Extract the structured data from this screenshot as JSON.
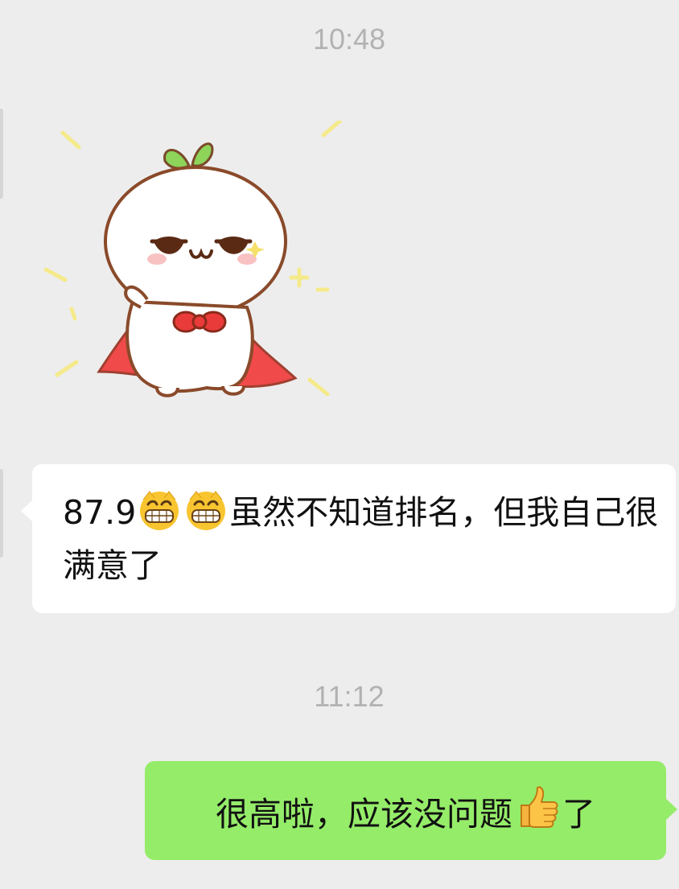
{
  "timestamps": [
    "10:48",
    "11:12"
  ],
  "messages": {
    "received": {
      "score": "87.9",
      "emoji_1": "grinning-face-icon",
      "emoji_2": "grinning-face-icon",
      "text": "虽然不知道排名，但我自己很满意了"
    },
    "sent": {
      "text_before": "很高啦，应该没问题",
      "emoji": "thumbs-up-icon",
      "text_after": "了"
    }
  },
  "sticker": {
    "name": "seedling-hero-sticker"
  },
  "colors": {
    "background": "#ededed",
    "received_bubble": "#ffffff",
    "sent_bubble": "#95ec69",
    "timestamp": "#b2b2b2",
    "cape": "#f04a4a",
    "leaf": "#8ed35a",
    "bow": "#ea3b3b"
  }
}
